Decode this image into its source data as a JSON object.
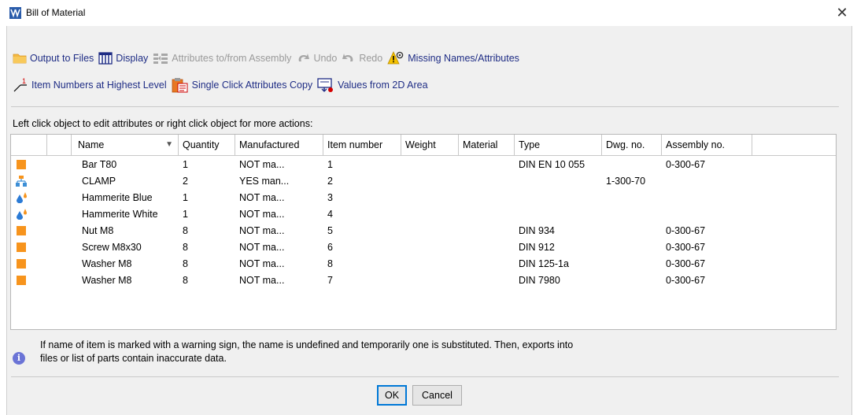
{
  "window": {
    "title": "Bill of Material",
    "close_glyph": "✕"
  },
  "toolbar": {
    "row1": [
      {
        "label": "Output to Files",
        "icon": "folder-icon",
        "enabled": true
      },
      {
        "label": "Display",
        "icon": "columns-icon",
        "enabled": true
      },
      {
        "label": "Attributes to/from Assembly",
        "icon": "attributes-icon",
        "enabled": false
      },
      {
        "label": "Undo",
        "icon": "undo-icon",
        "enabled": false
      },
      {
        "label": "Redo",
        "icon": "redo-icon",
        "enabled": false
      },
      {
        "label": "Missing Names/Attributes",
        "icon": "warning-gear-icon",
        "enabled": true
      }
    ],
    "row2": [
      {
        "label": "Item Numbers at Highest Level",
        "icon": "item-number-icon",
        "enabled": true
      },
      {
        "label": "Single Click Attributes Copy",
        "icon": "clipboard-copy-icon",
        "enabled": true
      },
      {
        "label": "Values from 2D Area",
        "icon": "monitor-arrow-icon",
        "enabled": true
      }
    ]
  },
  "hint": "Left click object to edit attributes or right click object for more actions:",
  "table": {
    "columns": [
      "",
      "",
      "Name",
      "Quantity",
      "Manufactured",
      "Item number",
      "Weight",
      "Material",
      "Type",
      "Dwg. no.",
      "Assembly no.",
      ""
    ],
    "sort_glyph": "▼",
    "rows": [
      {
        "icon": "part-icon",
        "name": "Bar T80",
        "quantity": "1",
        "manufactured": "NOT ma...",
        "item_number": "1",
        "weight": "",
        "material": "",
        "type": "DIN EN 10 055",
        "dwg_no": "",
        "assembly_no": "0-300-67"
      },
      {
        "icon": "assembly-icon",
        "name": "CLAMP",
        "quantity": "2",
        "manufactured": "YES man...",
        "item_number": "2",
        "weight": "",
        "material": "",
        "type": "",
        "dwg_no": "1-300-70",
        "assembly_no": ""
      },
      {
        "icon": "paint-drops-icon",
        "name": "Hammerite Blue",
        "quantity": "1",
        "manufactured": "NOT ma...",
        "item_number": "3",
        "weight": "",
        "material": "",
        "type": "",
        "dwg_no": "",
        "assembly_no": ""
      },
      {
        "icon": "paint-drops-icon",
        "name": "Hammerite White",
        "quantity": "1",
        "manufactured": "NOT ma...",
        "item_number": "4",
        "weight": "",
        "material": "",
        "type": "",
        "dwg_no": "",
        "assembly_no": ""
      },
      {
        "icon": "part-icon",
        "name": "Nut M8",
        "quantity": "8",
        "manufactured": "NOT ma...",
        "item_number": "5",
        "weight": "",
        "material": "",
        "type": "DIN 934",
        "dwg_no": "",
        "assembly_no": "0-300-67"
      },
      {
        "icon": "part-icon",
        "name": "Screw M8x30",
        "quantity": "8",
        "manufactured": "NOT ma...",
        "item_number": "6",
        "weight": "",
        "material": "",
        "type": "DIN 912",
        "dwg_no": "",
        "assembly_no": "0-300-67"
      },
      {
        "icon": "part-icon",
        "name": "Washer M8",
        "quantity": "8",
        "manufactured": "NOT ma...",
        "item_number": "8",
        "weight": "",
        "material": "",
        "type": "DIN 125-1a",
        "dwg_no": "",
        "assembly_no": "0-300-67"
      },
      {
        "icon": "part-icon",
        "name": "Washer M8",
        "quantity": "8",
        "manufactured": "NOT ma...",
        "item_number": "7",
        "weight": "",
        "material": "",
        "type": "DIN 7980",
        "dwg_no": "",
        "assembly_no": "0-300-67"
      }
    ]
  },
  "info": {
    "glyph": "i",
    "line1": "If name of item is marked with a warning sign, the name is undefined and temporarily one is substituted. Then, exports into",
    "line2": "files or list of parts contain inaccurate data."
  },
  "buttons": {
    "ok": "OK",
    "cancel": "Cancel"
  },
  "item_level_number": "1",
  "colors": {
    "link_blue": "#1f2d85",
    "disabled_gray": "#9a9a9a",
    "part_orange": "#f7941d",
    "assembly_blue": "#3d8fd6",
    "ok_focus": "#0078d7"
  }
}
